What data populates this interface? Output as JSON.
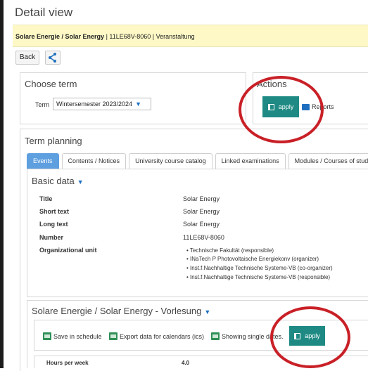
{
  "page": {
    "title": "Detail view"
  },
  "breadcrumb": {
    "title": "Solare Energie / Solar Energy",
    "rest": " | 11LE68V-8060 | Veranstaltung"
  },
  "toolbar": {
    "back_label": "Back",
    "share_icon": "share-icon"
  },
  "choose_term": {
    "heading": "Choose term",
    "term_label": "Term",
    "term_value": "Wintersemester 2023/2024"
  },
  "actions": {
    "heading": "Actions",
    "apply_label": "apply",
    "reports_label": "Reports"
  },
  "term_planning": {
    "heading": "Term planning",
    "tabs": [
      "Events",
      "Contents / Notices",
      "University course catalog",
      "Linked examinations",
      "Modules / Courses of study"
    ]
  },
  "basic_data": {
    "heading": "Basic data",
    "rows": [
      {
        "label": "Title",
        "value": "Solar Energy"
      },
      {
        "label": "Short text",
        "value": "Solar Energy"
      },
      {
        "label": "Long text",
        "value": "Solar Energy"
      },
      {
        "label": "Number",
        "value": "11LE68V-8060"
      },
      {
        "label": "Organizational unit",
        "value": ""
      }
    ],
    "org_units": [
      "Technische Fakultät (responsible)",
      "INaTech P Photovoltaische Energiekonv (organizer)",
      "Inst.f.Nachhaltige Technische Systeme-VB (co-organizer)",
      "Inst.f.Nachhaltige Technische Systeme-VB (responsible)"
    ]
  },
  "lecture": {
    "heading": "Solare Energie / Solar Energy - Vorlesung",
    "save_schedule": "Save in schedule",
    "export_ics": "Export data for calendars (ics)",
    "single_dates": "Showing single dates.",
    "apply_label": "apply",
    "hours_label": "Hours per week",
    "hours_value": "4.0"
  },
  "colors": {
    "accent": "#1f8a84",
    "tab_active": "#5e9fe0",
    "highlight": "#c92027",
    "crumb_bg": "#fdf8c6"
  }
}
